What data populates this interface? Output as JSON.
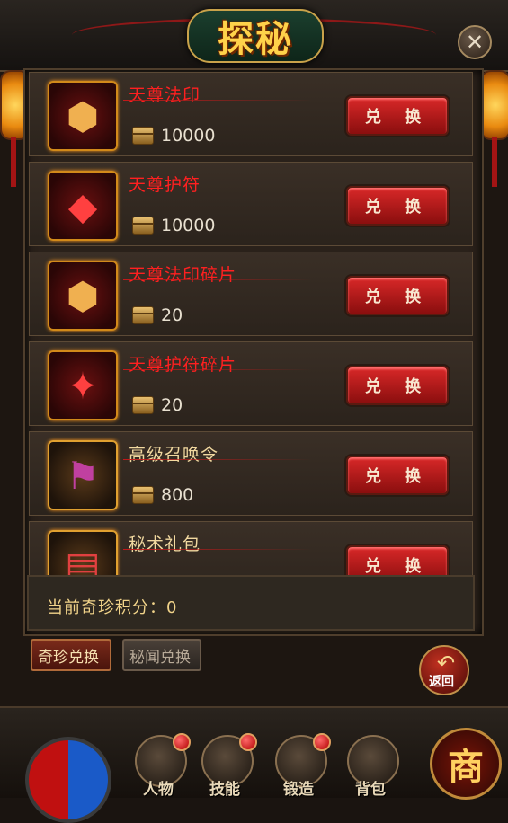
{
  "title": "探秘",
  "close_icon": "close-icon",
  "items": [
    {
      "name": "天尊法印",
      "cost": "10000",
      "name_color": "red",
      "icon": "seal-icon",
      "button": "兑 换"
    },
    {
      "name": "天尊护符",
      "cost": "10000",
      "name_color": "red",
      "icon": "amulet-icon",
      "button": "兑 换"
    },
    {
      "name": "天尊法印碎片",
      "cost": "20",
      "name_color": "red",
      "icon": "seal-fragment-icon",
      "button": "兑 换"
    },
    {
      "name": "天尊护符碎片",
      "cost": "20",
      "name_color": "red",
      "icon": "amulet-fragment-icon",
      "button": "兑 换"
    },
    {
      "name": "高级召唤令",
      "cost": "800",
      "name_color": "gold",
      "icon": "summon-order-icon",
      "button": "兑 换"
    },
    {
      "name": "秘术礼包",
      "cost": "",
      "name_color": "gold",
      "icon": "gift-pack-icon",
      "button": "兑 换"
    }
  ],
  "score_label": "当前奇珍积分：0",
  "tabs": {
    "active": "奇珍兑换",
    "inactive": "秘闻兑换"
  },
  "return_label": "返回",
  "bottom_nav": [
    {
      "label": "人物",
      "icon": "character-icon",
      "has_dot": true
    },
    {
      "label": "技能",
      "icon": "skill-scroll-icon",
      "has_dot": true
    },
    {
      "label": "锻造",
      "icon": "forge-icon",
      "has_dot": true
    },
    {
      "label": "背包",
      "icon": "backpack-icon",
      "has_dot": false
    }
  ],
  "shop_label": "商",
  "colors": {
    "accent_red": "#ff2020",
    "button_red": "#c81e1e",
    "gold_text": "#f2d48a"
  }
}
